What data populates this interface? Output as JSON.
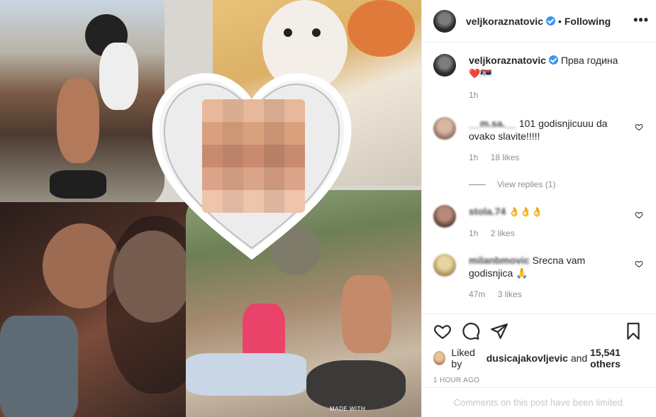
{
  "post": {
    "username": "veljkoraznatovic",
    "separator": "•",
    "follow_status": "Following",
    "more": "•••"
  },
  "media": {
    "watermark": "MADE WITH"
  },
  "comments": [
    {
      "username": "veljkoraznatovic",
      "text": "Прва година",
      "emoji": "❤️🇷🇸",
      "time": "1h"
    },
    {
      "username": "__m.sa.__",
      "text": "101 godisnjicuuu da ovako slavite!!!!!",
      "time": "1h",
      "likes": "18 likes",
      "view_replies": "View replies (1)"
    },
    {
      "username": "stola.74",
      "text": "👌👌👌",
      "time": "1h",
      "likes": "2 likes"
    },
    {
      "username": "milanbmovic",
      "text": "Srecna vam godisnjica 🙏",
      "time": "47m",
      "likes": "3 likes"
    }
  ],
  "footer": {
    "liked_by_prefix": "Liked by",
    "liked_by_user": "dusicajakovljevic",
    "liked_by_and": "and",
    "liked_by_others": "15,541 others",
    "posted_time": "1 HOUR AGO",
    "limited": "Comments on this post have been limited."
  },
  "colors": {
    "verified": "#3897f0",
    "like_heart": "#ed4956",
    "muted": "#8e8e8e"
  },
  "icons": [
    "verified-badge-icon",
    "more-options-icon",
    "heart-icon",
    "comment-icon",
    "share-icon",
    "bookmark-icon"
  ]
}
